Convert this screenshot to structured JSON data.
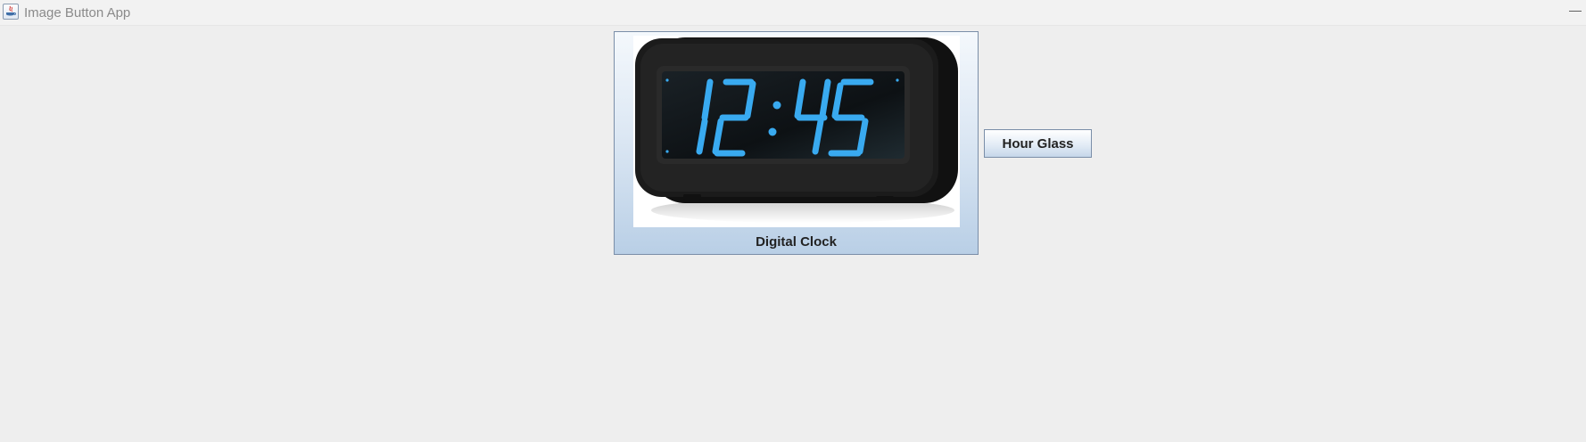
{
  "window": {
    "title": "Image Button App",
    "minimize_label": "—"
  },
  "buttons": {
    "digital_clock": {
      "label": "Digital Clock",
      "display_time": "12:45"
    },
    "hour_glass": {
      "label": "Hour Glass"
    }
  },
  "colors": {
    "background": "#eeeeee",
    "button_border": "#7a8ea8",
    "clock_digits": "#39aaf0",
    "clock_body": "#1b1b1b"
  },
  "icons": {
    "app": "java-app-icon",
    "minimize": "minimize-icon"
  }
}
